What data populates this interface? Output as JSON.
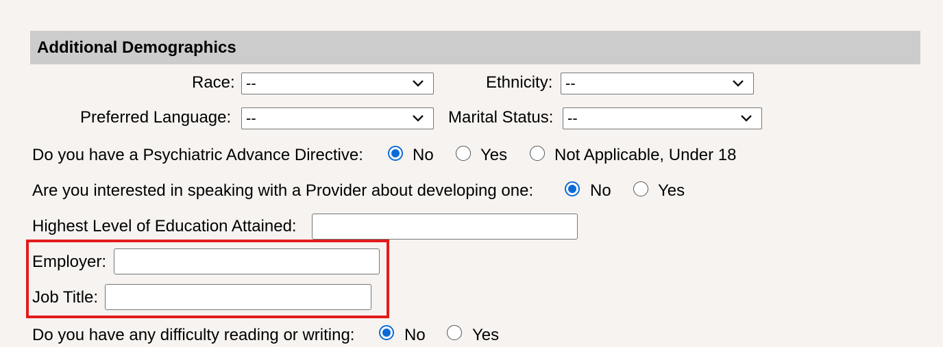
{
  "section": {
    "title": "Additional Demographics"
  },
  "race": {
    "label": "Race:",
    "value": "--"
  },
  "ethnicity": {
    "label": "Ethnicity:",
    "value": "--"
  },
  "preferred_language": {
    "label": "Preferred Language:",
    "value": "--"
  },
  "marital_status": {
    "label": "Marital Status:",
    "value": "--"
  },
  "advance_directive": {
    "question": "Do you have a Psychiatric Advance Directive:",
    "options": [
      "No",
      "Yes",
      "Not Applicable, Under 18"
    ],
    "selected": "No"
  },
  "provider_interest": {
    "question": "Are you interested in speaking with a Provider about developing one:",
    "options": [
      "No",
      "Yes"
    ],
    "selected": "No"
  },
  "education": {
    "label": "Highest Level of Education Attained:",
    "value": ""
  },
  "employer": {
    "label": "Employer:",
    "value": ""
  },
  "job_title": {
    "label": "Job Title:",
    "value": ""
  },
  "reading_difficulty": {
    "question": "Do you have any difficulty reading or writing:",
    "options": [
      "No",
      "Yes"
    ],
    "selected": "No"
  },
  "highlight_color": "#e31b1b",
  "radio_accent_color": "#0b6bd6"
}
